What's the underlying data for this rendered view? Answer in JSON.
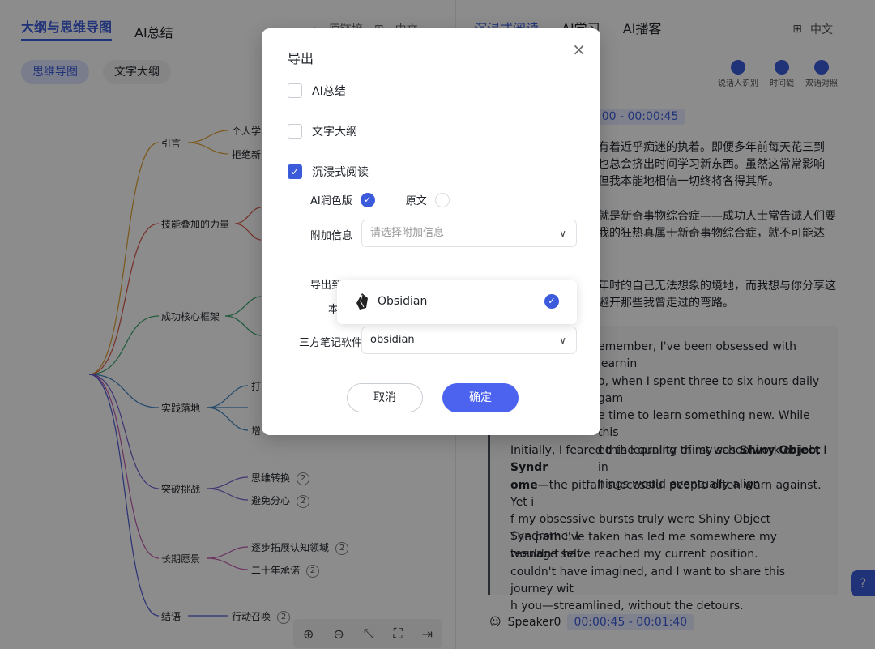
{
  "left_panel": {
    "tabs": [
      {
        "label": "大纲与思维导图"
      },
      {
        "label": "AI总结"
      }
    ],
    "tools": [
      "原链接",
      "中文"
    ],
    "pills": [
      "思维导图",
      "文字大纲"
    ],
    "mind_nodes": {
      "n1": "引言",
      "n1a": "个人学",
      "n1b": "拒绝新",
      "n2": "技能叠加的力量",
      "n3": "成功核心框架",
      "n4": "实践落地",
      "n4a": "打",
      "n4b": "一",
      "n4c": "增",
      "n5": "突破挑战",
      "n5a": "思维转换",
      "n5b": "避免分心",
      "n6": "长期愿景",
      "n6a": "逐步拓展认知领域",
      "n6b": "二十年承诺",
      "n7": "结语",
      "n7a": "行动召唤"
    },
    "badge": "2",
    "bottom_tools": [
      "⊕",
      "⊖",
      "⤡",
      "⛶",
      "⇥"
    ]
  },
  "right_panel": {
    "tabs": [
      "沉浸式阅读",
      "AI学习",
      "AI播客"
    ],
    "lang": "中文",
    "icons": [
      {
        "label": "说话人识别"
      },
      {
        "label": "时间戳"
      },
      {
        "label": "双语对照"
      }
    ],
    "time1": ":00 - 00:00:45",
    "zh_paragraphs": [
      "有着近乎痴迷的执着。即便多年前每天花三到",
      "也总会挤出时间学习新东西。虽然这常常影响",
      "但我本能地相信一切终将各得其所。",
      "就是新奇事物综合症——成功人士常告诫人们要",
      "我的狂热真属于新奇事物综合症，就不可能达",
      "年时的自己无法想象的境地，而我想与你分享这",
      "避开那些我曾走过的弯路。"
    ],
    "en_paragraphs": [
      "emember, I've been obsessed with learnin",
      "o, when I spent three to six hours daily gam",
      "e time to learn something new. While this",
      "ed the quality of my schoolwork or job, I in",
      "hings would eventually align.",
      "Initially, I feared this learning thirst was",
      "Shiny Object Syndr",
      "ome",
      "—the pitfall successful people often warn against. Yet i",
      "f my obsessive bursts truly were Shiny Object Syndrome, I",
      "wouldn't have reached my current position.",
      "The path I've taken has led me somewhere my teenage self",
      "couldn't have imagined, and I want to share this journey wit",
      "h you—streamlined, without the detours."
    ],
    "speaker": "Speaker0",
    "time2": "00:00:45 - 00:01:40",
    "help": "?"
  },
  "modal": {
    "title": "导出",
    "options": [
      {
        "label": "AI总结",
        "checked": false
      },
      {
        "label": "文字大纲",
        "checked": false
      },
      {
        "label": "沉浸式阅读",
        "checked": true
      }
    ],
    "sub_options": [
      {
        "label": "AI润色版",
        "checked": true
      },
      {
        "label": "原文",
        "checked": false
      }
    ],
    "extra_label": "附加信息",
    "extra_placeholder": "请选择附加信息",
    "export_to_label": "导出到",
    "local_label": "本",
    "dropdown_item": "Obsidian",
    "third_party_label": "三方笔记软件",
    "third_party_value": "obsidian",
    "cancel": "取消",
    "confirm": "确定",
    "close": "×",
    "check": "✓",
    "chev": "∨"
  },
  "colors": {
    "accent": "#3b5bdb",
    "overlay": "rgba(0,0,0,0.45)"
  }
}
